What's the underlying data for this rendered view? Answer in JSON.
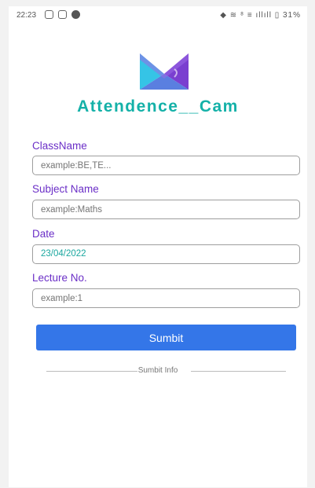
{
  "status_bar": {
    "time": "22:23",
    "right_info": "◆ ≋ ⁸ ≡ ıllıll ▯ 31%",
    "left_icons": [
      "notification-icon",
      "instagram-icon",
      "app-icon"
    ]
  },
  "app": {
    "title": "Attendence__Cam",
    "logo_icon": "attendance-cam-logo"
  },
  "form": {
    "class_name": {
      "label": "ClassName",
      "placeholder": "example:BE,TE...",
      "value": ""
    },
    "subject_name": {
      "label": "Subject Name",
      "placeholder": "example:Maths",
      "value": ""
    },
    "date": {
      "label": "Date",
      "placeholder": "",
      "value": "23/04/2022"
    },
    "lecture_no": {
      "label": "Lecture No.",
      "placeholder": "example:1",
      "value": ""
    },
    "submit_label": "Sumbit",
    "divider_text": "Sumbit Info"
  },
  "colors": {
    "accent_teal": "#14b1a8",
    "label_purple": "#6b2fc7",
    "button_blue": "#3476e8"
  }
}
